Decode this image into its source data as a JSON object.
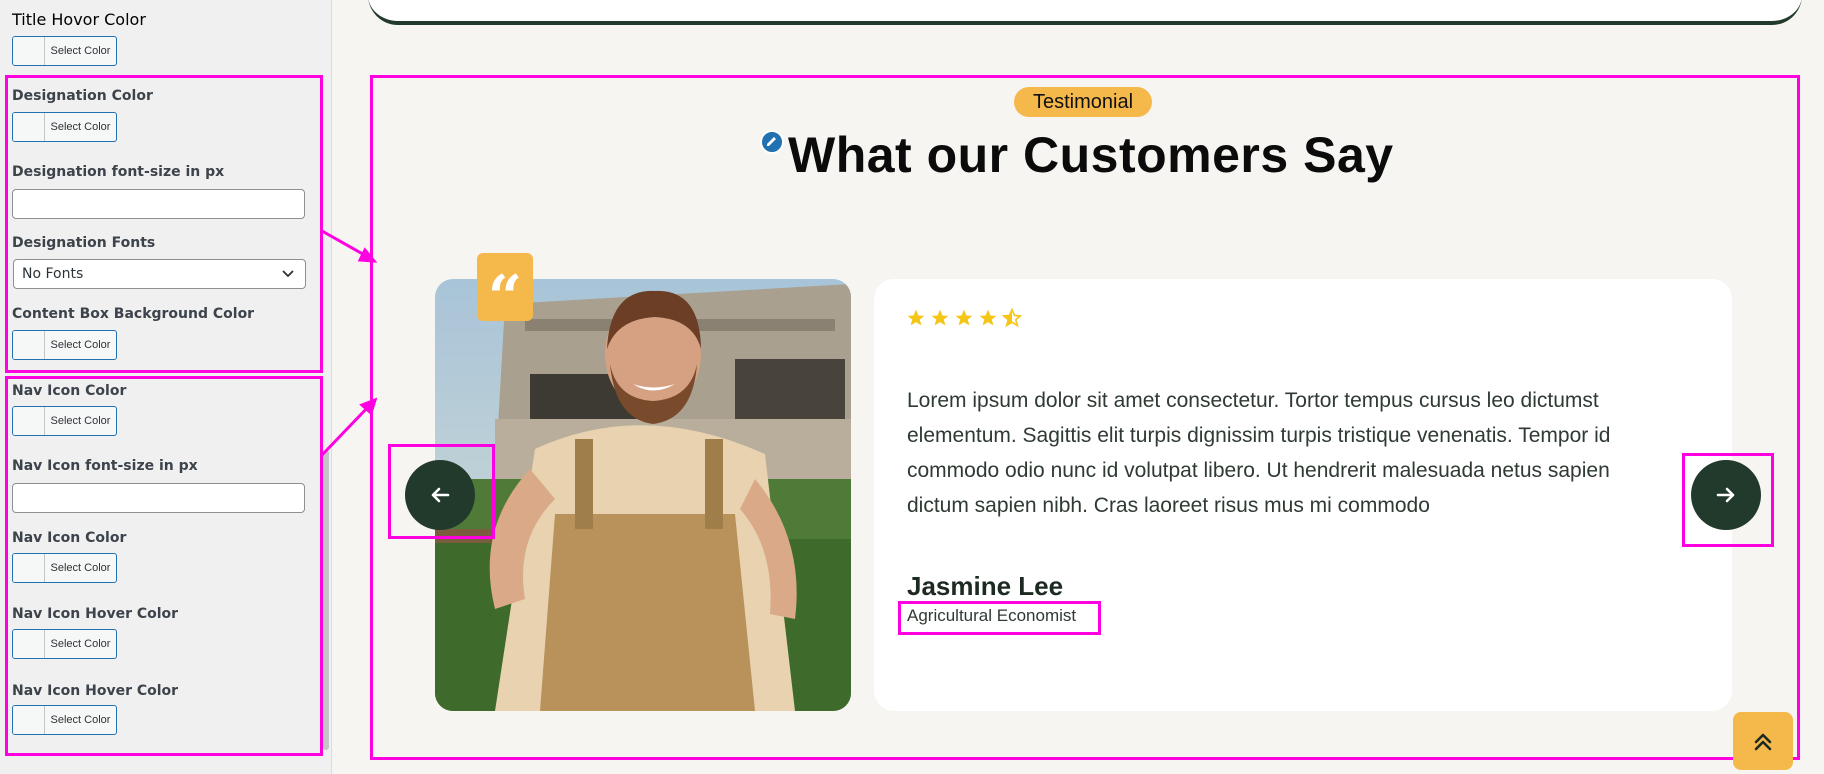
{
  "sidebar": {
    "select_color_label": "Select Color",
    "fields": [
      {
        "label": "Title Hovor Color",
        "type": "color"
      },
      {
        "label": "Designation Color",
        "type": "color"
      },
      {
        "label": "Designation font-size in px",
        "type": "text",
        "value": ""
      },
      {
        "label": "Designation Fonts",
        "type": "select",
        "value": "No Fonts"
      },
      {
        "label": "Content Box Background Color",
        "type": "color"
      },
      {
        "label": "Nav Icon Color",
        "type": "color"
      },
      {
        "label": "Nav Icon font-size in px",
        "type": "text",
        "value": ""
      },
      {
        "label": "Nav Icon Color",
        "type": "color"
      },
      {
        "label": "Nav Icon Hover Color",
        "type": "color"
      },
      {
        "label": "Nav Icon Hover Color",
        "type": "color"
      }
    ]
  },
  "section": {
    "badge": "Testimonial",
    "heading": "What our Customers Say"
  },
  "testimonial": {
    "rating": 4.5,
    "review": "Lorem ipsum dolor sit amet consectetur. Tortor tempus cursus leo dictumst elementum. Sagittis elit turpis dignissim turpis tristique venenatis. Tempor id commodo odio nunc id volutpat libero. Ut hendrerit malesuada netus sapien dictum sapien nibh. Cras laoreet risus mus mi commodo",
    "name": "Jasmine Lee",
    "designation": "Agricultural Economist"
  },
  "colors": {
    "accent": "#f5b84b",
    "dark": "#223a2c",
    "annotation": "#ff00e0",
    "star": "#f5c518"
  },
  "icons": {
    "quote": "quote-icon",
    "prev": "arrow-left-icon",
    "next": "arrow-right-icon",
    "scroll_top": "double-chevron-up-icon",
    "edit": "pencil-icon"
  }
}
